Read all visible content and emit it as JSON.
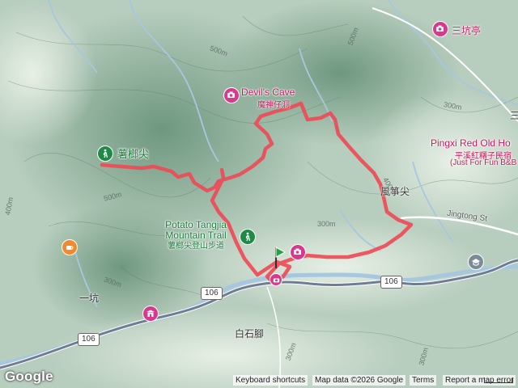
{
  "map": {
    "type": "terrain",
    "colors": {
      "terrain_light": "#cfe0d1",
      "terrain_dark": "#7fa58d",
      "track": "#ee4b57",
      "road": "#6d7d96",
      "river": "#a7c7e0",
      "poi": "#d63a8c",
      "park": "#1e8a46"
    }
  },
  "places": {
    "devils_cave_en": "Devil's Cave",
    "devils_cave_zh": "魔神仔洞",
    "shubangjian": "薯榔尖",
    "potato_trail_en_1": "Potato Tangjia",
    "potato_trail_en_2": "Mountain Trail",
    "potato_trail_zh": "薯榔尖登山步道",
    "pingxi_red_en": "Pingxi Red Old Ho",
    "pingxi_red_zh": "平溪紅糬子民宿",
    "pingxi_red_sub": "(Just For Fun B&B",
    "sankengting": "三坑亭",
    "fengzhengjian": "風箏尖",
    "jingtong": "Jingtong St",
    "yikeng": "一坑",
    "baishijiao": "白石腳",
    "edge_char": "三"
  },
  "roads": {
    "route_106_a": "106",
    "route_106_b": "106",
    "route_106_c": "106"
  },
  "contours": {
    "c1": "500m",
    "c2": "500m",
    "c3": "500m",
    "c4": "400m",
    "c5": "400m",
    "c6": "300m",
    "c7": "300m",
    "c8": "300m",
    "c9": "300m",
    "c10": "300m"
  },
  "icons": {
    "poi": "camera-icon",
    "park": "hiker-icon",
    "cafe": "coffee-icon",
    "shrine": "shrine-icon",
    "school": "school-icon",
    "start": "start-flag-icon"
  },
  "footer": {
    "logo": "Google",
    "keyboard": "Keyboard shortcuts",
    "map_data": "Map data ©2026 Google",
    "terms": "Terms",
    "report": "Report a map error"
  }
}
